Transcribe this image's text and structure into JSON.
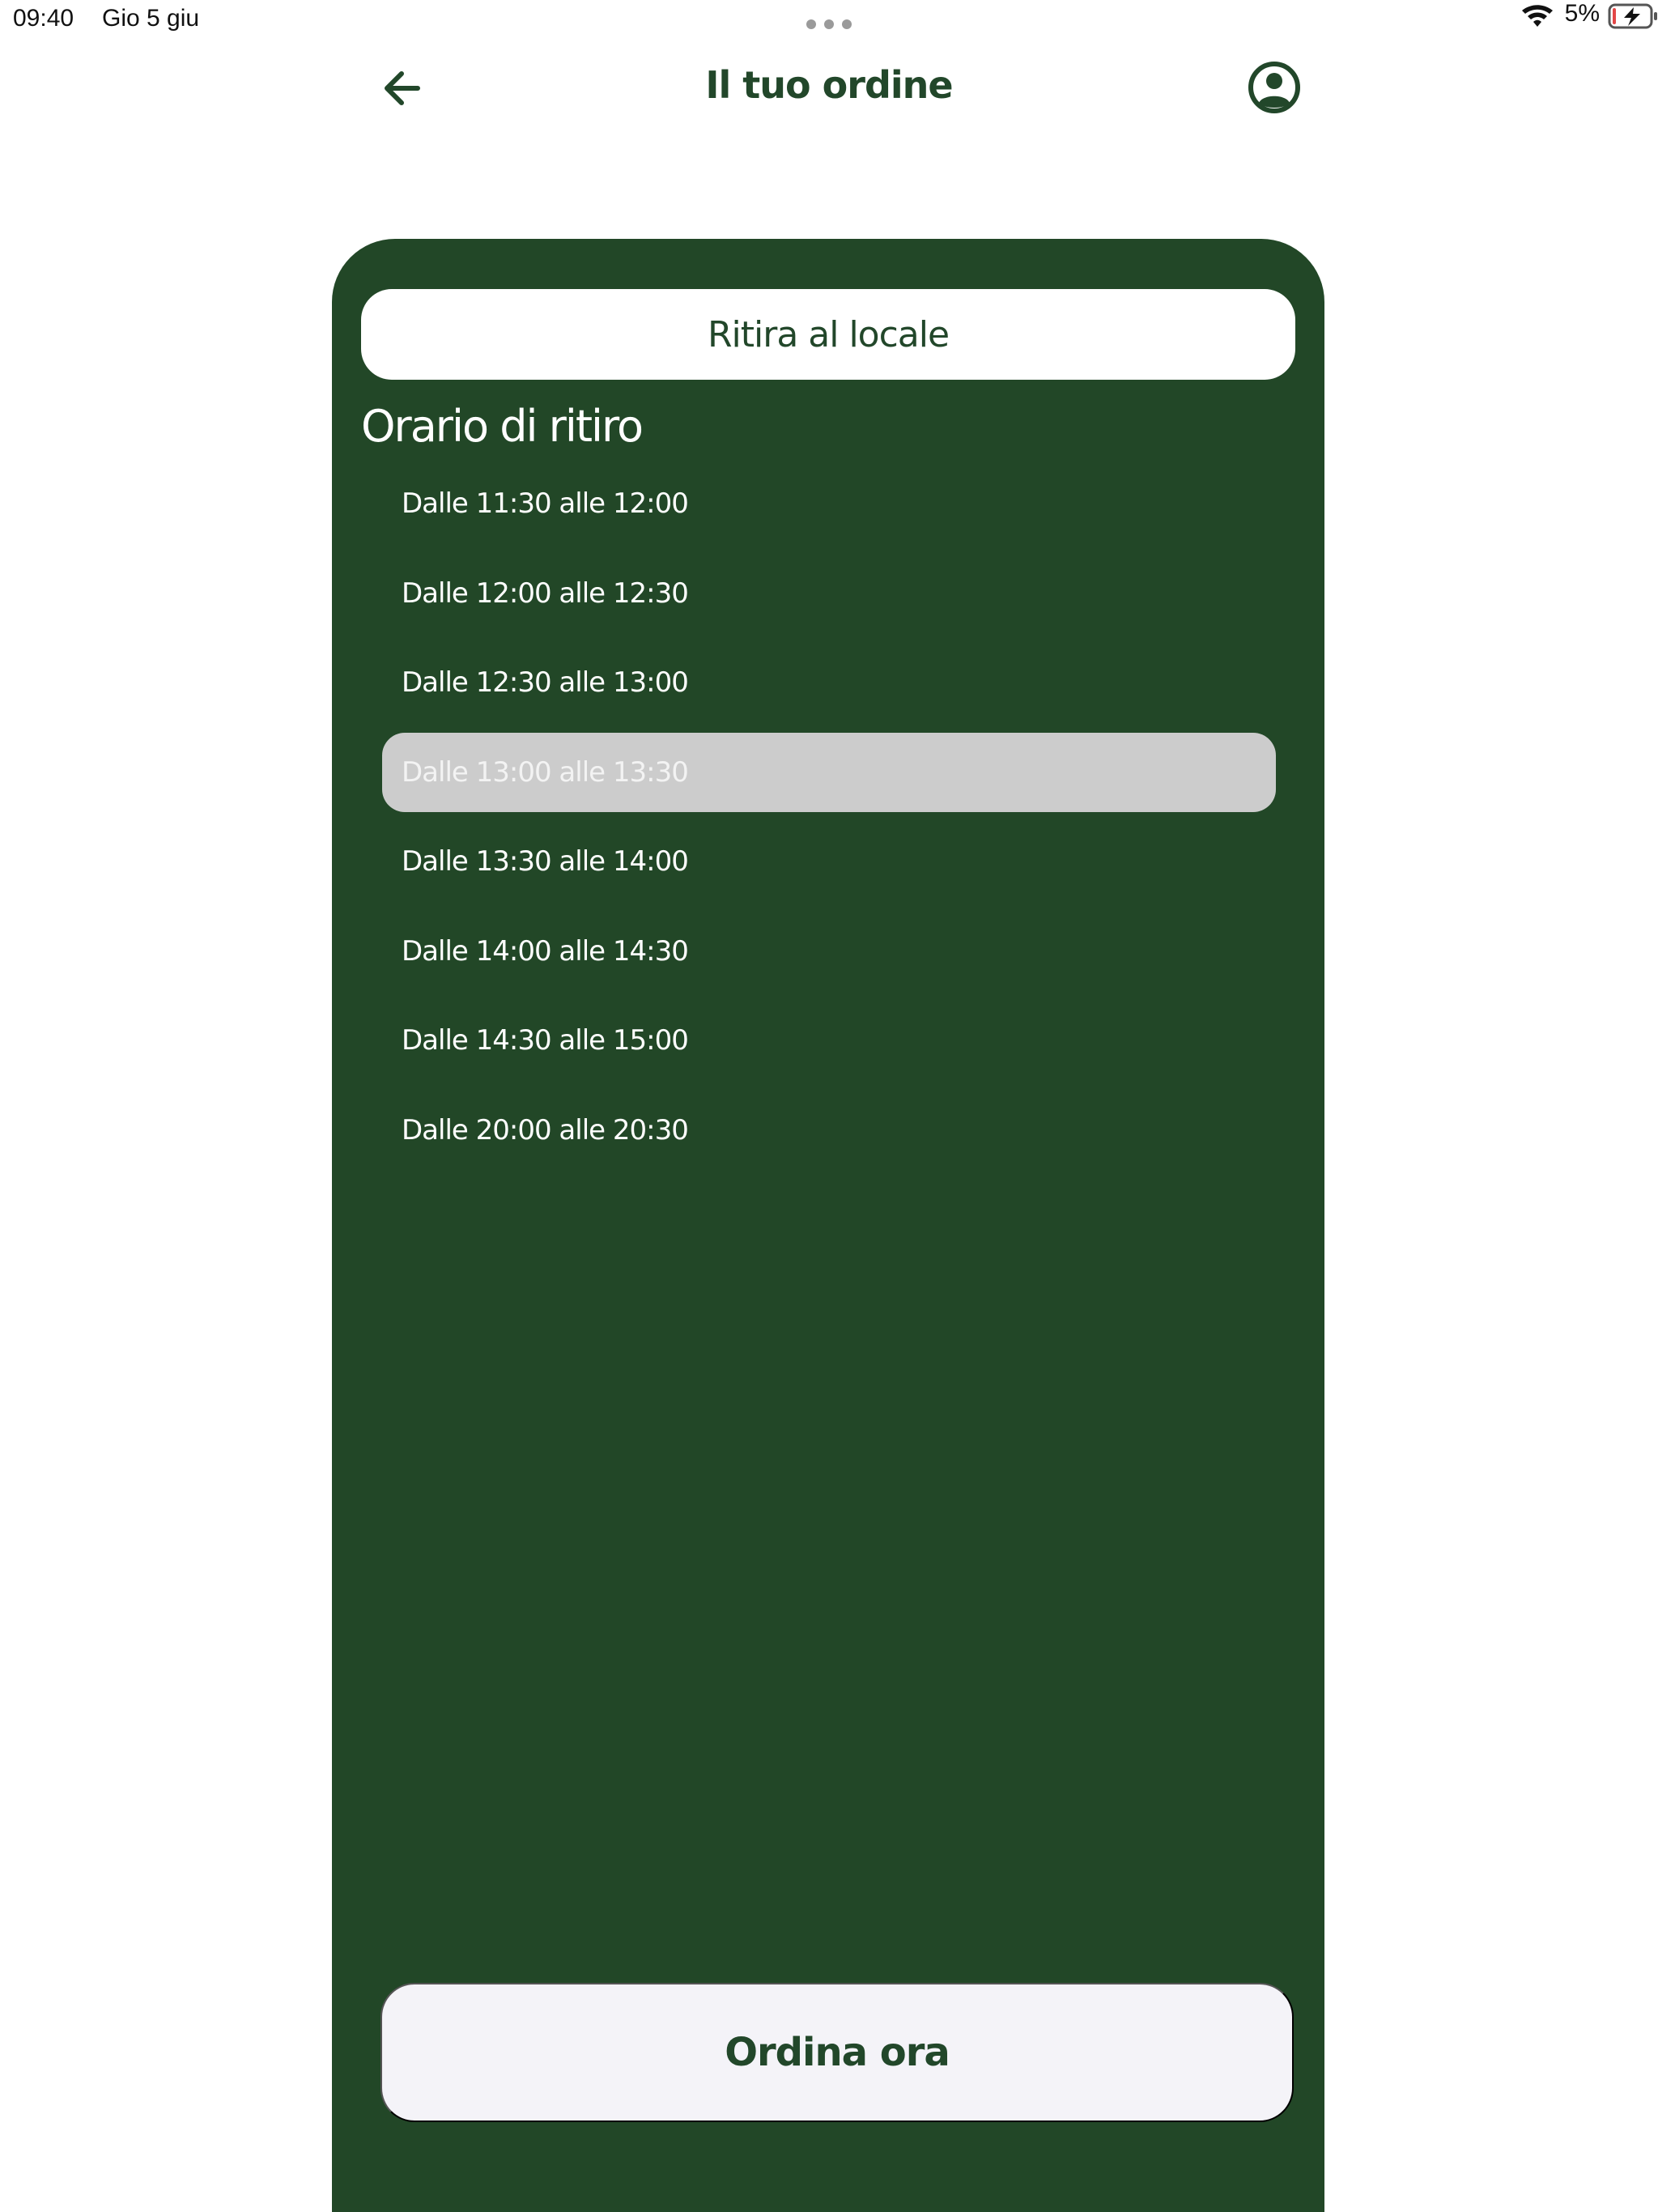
{
  "status_bar": {
    "time": "09:40",
    "date": "Gio 5 giu",
    "battery": "5%",
    "icons": [
      "multitasking-dots-icon",
      "wifi-icon",
      "battery-charging-icon"
    ]
  },
  "header": {
    "title": "Il tuo ordine",
    "back_icon": "arrow-left-icon",
    "profile_icon": "user-circle-icon"
  },
  "delivery": {
    "selected_mode": "Ritira al locale"
  },
  "pickup": {
    "title": "Orario di ritiro",
    "slots": [
      {
        "label": "Dalle 11:30 alle 12:00",
        "selected": false
      },
      {
        "label": "Dalle 12:00 alle 12:30",
        "selected": false
      },
      {
        "label": "Dalle 12:30 alle 13:00",
        "selected": false
      },
      {
        "label": "Dalle 13:00 alle 13:30",
        "selected": true
      },
      {
        "label": "Dalle 13:30 alle 14:00",
        "selected": false
      },
      {
        "label": "Dalle 14:00 alle 14:30",
        "selected": false
      },
      {
        "label": "Dalle 14:30 alle 15:00",
        "selected": false
      },
      {
        "label": "Dalle 20:00 alle 20:30",
        "selected": false
      }
    ]
  },
  "actions": {
    "order_label": "Ordina ora"
  },
  "colors": {
    "brand_green": "#224727",
    "selected_slot": "#cccccc",
    "button_background": "#f4f3f8"
  }
}
